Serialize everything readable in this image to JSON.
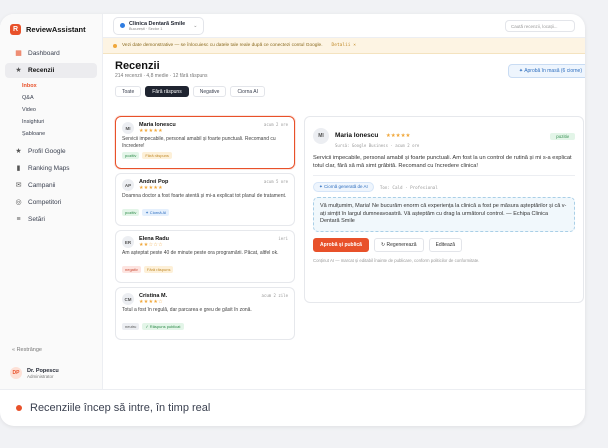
{
  "app": {
    "brand_name": "ReviewAssistant",
    "brand_letter": "R",
    "accent": "#e8512a"
  },
  "sidebar": {
    "items": [
      {
        "label": "Dashboard",
        "icon": "grid-icon"
      },
      {
        "label": "Recenzii",
        "icon": "star-icon"
      }
    ],
    "sub_items": [
      "Inbox",
      "Q&A",
      "Video",
      "Insighturi",
      "Șabloane"
    ],
    "items_after": [
      {
        "label": "Profil Google",
        "icon": "star-icon"
      },
      {
        "label": "Ranking Maps",
        "icon": "bar-chart-icon"
      },
      {
        "label": "Campanii",
        "icon": "mail-icon"
      },
      {
        "label": "Competitori",
        "icon": "target-icon"
      },
      {
        "label": "Setări",
        "icon": "sliders-icon"
      }
    ],
    "collapse_label": "« Restrânge",
    "user": {
      "initials": "DP",
      "name": "Dr. Popescu",
      "role": "Administrator"
    }
  },
  "topbar": {
    "clinic_name": "Clinica Dentară Smile",
    "clinic_sub": "București · Sector 1",
    "search_placeholder": "Caută recenzii, locații..."
  },
  "banner": {
    "text": "Vezi date demonstrative — se înlocuiesc cu datele tale reale după ce conectezi contul Google.",
    "link": "Detalii ×"
  },
  "page": {
    "title": "Recenzii",
    "subtitle": "214 recenzii · 4,8 medie · 12 fără răspuns",
    "approve_all": "✦ Aprobă în masă (6 ciorne)"
  },
  "tabs": [
    "Toate",
    "Fără răspuns",
    "Negative",
    "Ciorna AI"
  ],
  "reviews": [
    {
      "initials": "MI",
      "name": "Maria Ionescu",
      "stars": "★★★★★",
      "time": "acum 2 ore",
      "text": "Servicii impecabile, personal amabil și foarte punctuali. Recomand cu încredere!",
      "tags": [
        {
          "label": "pozitiv",
          "kind": "pos"
        },
        {
          "label": "Fără răspuns",
          "kind": "warn"
        }
      ]
    },
    {
      "initials": "AP",
      "name": "Andrei Pop",
      "stars": "★★★★★",
      "time": "acum 5 ore",
      "text": "Doamna doctor a fost foarte atentă și mi-a explicat tot planul de tratament.",
      "tags": [
        {
          "label": "pozitiv",
          "kind": "pos"
        },
        {
          "label": "✦ Ciornă AI",
          "kind": "blue"
        }
      ]
    },
    {
      "initials": "ER",
      "name": "Elena Radu",
      "stars": "★★☆☆☆",
      "time": "ieri",
      "text": "Am așteptat peste 40 de minute peste ora programării. Păcat, altfel ok.",
      "tags": [
        {
          "label": "negativ",
          "kind": "neg"
        },
        {
          "label": "Fără răspuns",
          "kind": "warn"
        }
      ]
    },
    {
      "initials": "CM",
      "name": "Cristina M.",
      "stars": "★★★★☆",
      "time": "acum 2 zile",
      "text": "Totul a fost în regulă, dar parcarea e greu de găsit în zonă.",
      "tags": [
        {
          "label": "neutru",
          "kind": "neu"
        },
        {
          "label": "✓ Răspuns publicat",
          "kind": "pos"
        }
      ]
    }
  ],
  "detail": {
    "initials": "MI",
    "name": "Maria Ionescu",
    "stars": "★★★★★",
    "source": "Sursă: Google Business · acum 2 ore",
    "badge": "pozitiv",
    "text": "Servicii impecabile, personal amabil și foarte punctuali. Am fost la un control de rutină și mi s-a explicat totul clar, fără să mă simt grăbită. Recomand cu încredere clinica!",
    "ai_badge": "✦ Ciornă generată de AI",
    "ai_tone": "Ton: Cald · Profesional",
    "ai_reply": "Vă mulțumim, Maria! Ne bucurăm enorm că experiența la clinică a fost pe măsura așteptărilor și că v-ați simțit în largul dumneavoastră. Vă așteptăm cu drag la următorul control. — Echipa Clinica Dentară Smile",
    "btn_publish": "Aprobă și publică",
    "btn_regen": "↻ Regenerează",
    "btn_edit": "Editează",
    "footnote": "Conținut AI — marcat și editabil înainte de publicare, conform politicilor de conformitate."
  },
  "caption": "Recenziile încep să intre, în timp real"
}
